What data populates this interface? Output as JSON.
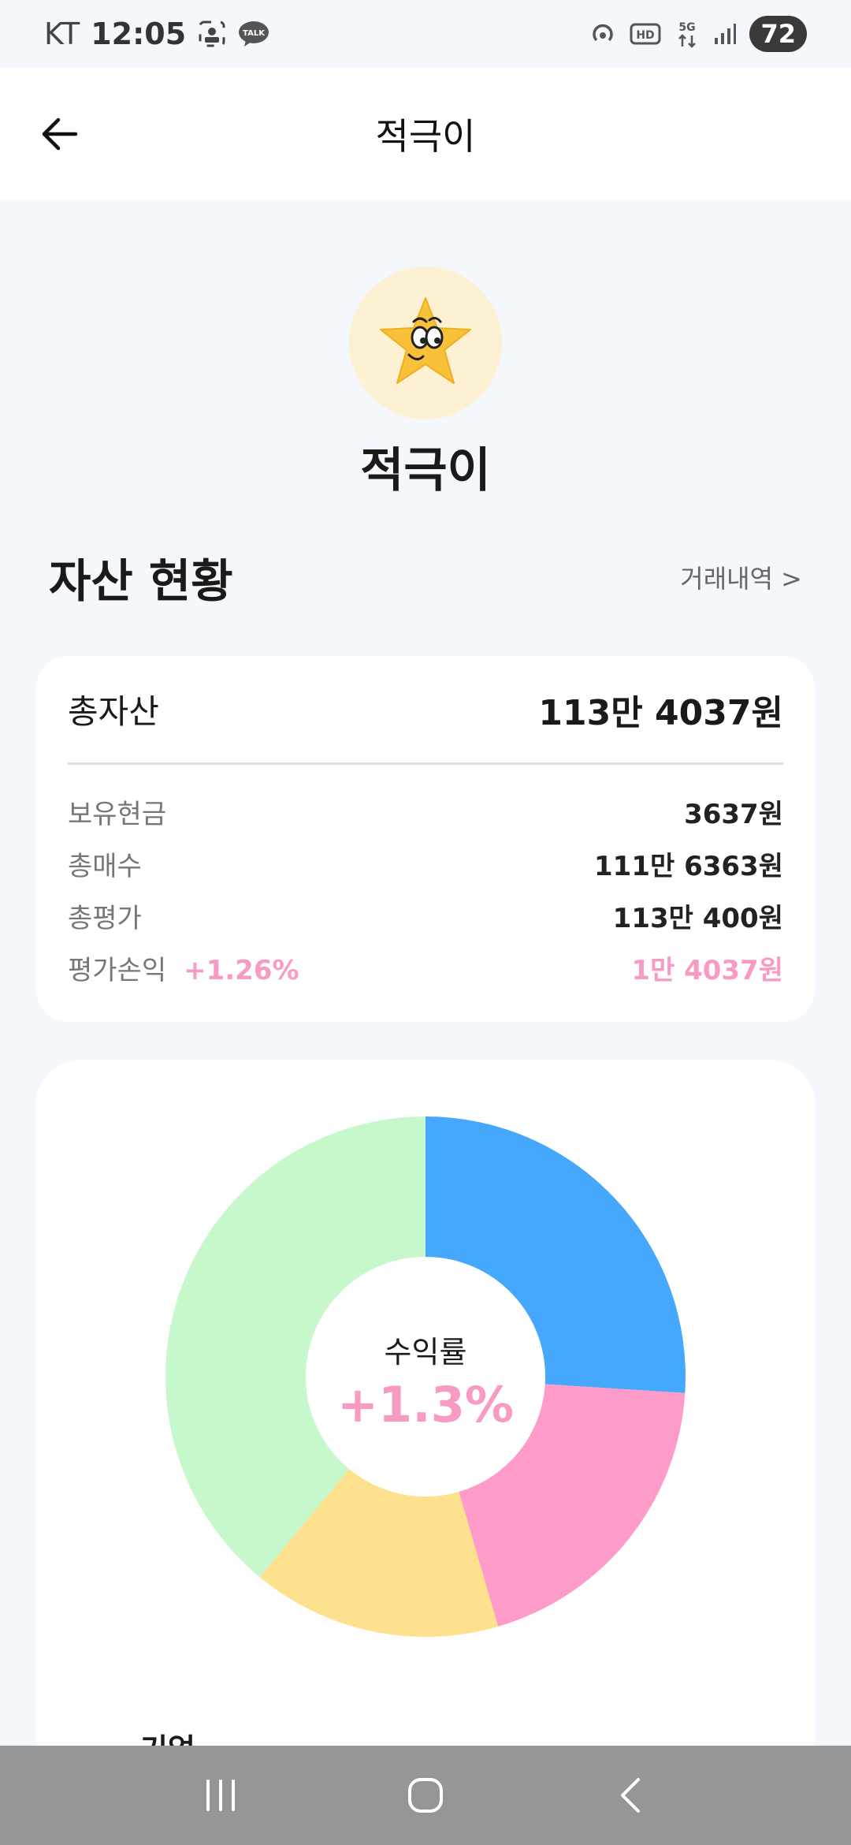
{
  "status_bar": {
    "carrier": "KT",
    "time": "12:05",
    "talk_badge": "TALK",
    "hd_badge": "HD",
    "network": "5G",
    "battery": "72"
  },
  "header": {
    "title": "적극이"
  },
  "profile": {
    "name": "적극이",
    "avatar_icon": "star-face-icon"
  },
  "assets": {
    "section_title": "자산 현황",
    "history_link": "거래내역 >",
    "total_label": "총자산",
    "total_value": "113만 4037원",
    "rows": [
      {
        "label": "보유현금",
        "value": "3637원"
      },
      {
        "label": "총매수",
        "value": "111만 6363원"
      },
      {
        "label": "총평가",
        "value": "113만 400원"
      },
      {
        "label": "평가손익",
        "rate": "+1.26%",
        "value": "1만 4037원"
      }
    ]
  },
  "chart_data": {
    "type": "pie",
    "center_label": "수익률",
    "center_value": "+1.3%",
    "slices": [
      {
        "value": 26,
        "color": "#45a8fc"
      },
      {
        "value": 19.5,
        "color": "#fe9bc8"
      },
      {
        "value": 15.5,
        "color": "#fee18e"
      },
      {
        "value": 39,
        "color": "#c7f8cc"
      }
    ],
    "legend_peek": "기업"
  },
  "colors": {
    "accent_pink": "#f79bc4",
    "background": "#f4f7fb",
    "nav_bar": "#959698"
  },
  "nav": {
    "recent_icon": "recent-apps-icon",
    "home_icon": "home-icon",
    "back_icon": "back-nav-icon"
  }
}
